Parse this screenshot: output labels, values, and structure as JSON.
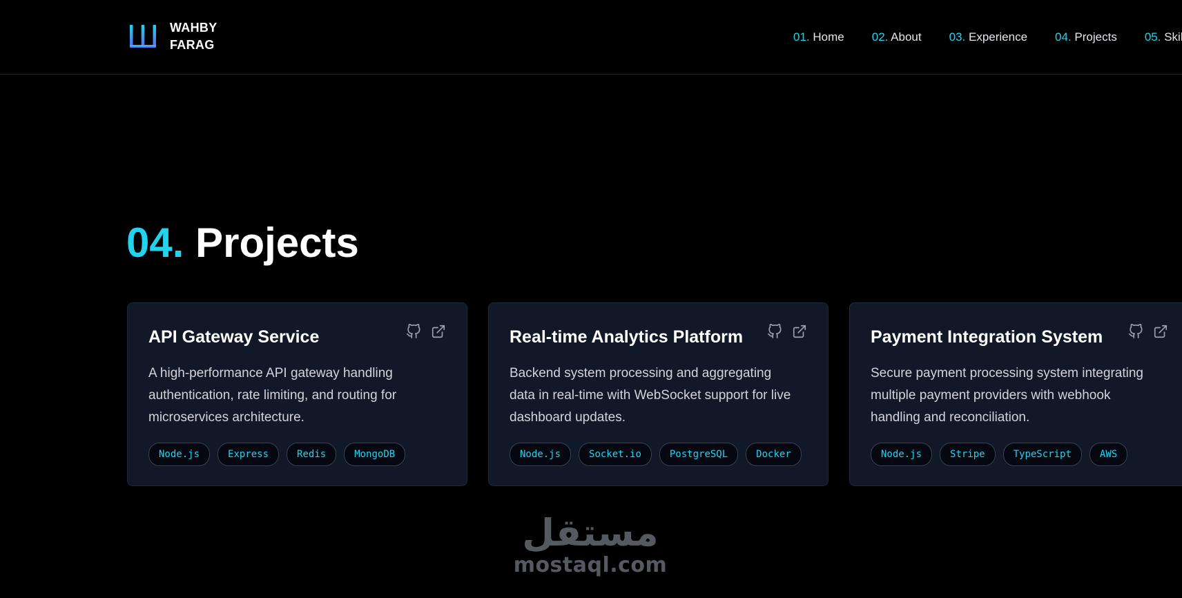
{
  "header": {
    "logo": {
      "icon": "w-monogram-icon",
      "name_line1": "WAHBY",
      "name_line2": "FARAG",
      "gradient_colors": [
        "#22d3ee",
        "#6366f1"
      ]
    },
    "nav": [
      {
        "num": "01.",
        "label": "Home"
      },
      {
        "num": "02.",
        "label": "About"
      },
      {
        "num": "03.",
        "label": "Experience"
      },
      {
        "num": "04.",
        "label": "Projects"
      },
      {
        "num": "05.",
        "label": "Skills"
      }
    ]
  },
  "section": {
    "num": "04.",
    "title": "Projects"
  },
  "projects": [
    {
      "title": "API Gateway Service",
      "description": "A high-performance API gateway handling authentication, rate limiting, and routing for microservices architecture.",
      "icons": [
        "github-icon",
        "external-link-icon"
      ],
      "tags": [
        "Node.js",
        "Express",
        "Redis",
        "MongoDB"
      ]
    },
    {
      "title": "Real-time Analytics Platform",
      "description": "Backend system processing and aggregating data in real-time with WebSocket support for live dashboard updates.",
      "icons": [
        "github-icon",
        "external-link-icon"
      ],
      "tags": [
        "Node.js",
        "Socket.io",
        "PostgreSQL",
        "Docker"
      ]
    },
    {
      "title": "Payment Integration System",
      "description": "Secure payment processing system integrating multiple payment providers with webhook handling and reconciliation.",
      "icons": [
        "github-icon",
        "external-link-icon"
      ],
      "tags": [
        "Node.js",
        "Stripe",
        "TypeScript",
        "AWS"
      ]
    }
  ],
  "watermark": {
    "arabic": "مستقل",
    "latin": "mostaql.com"
  },
  "colors": {
    "accent": "#22d3ee",
    "background": "#000000",
    "card_background": "#111827",
    "card_border": "#1f2937"
  }
}
